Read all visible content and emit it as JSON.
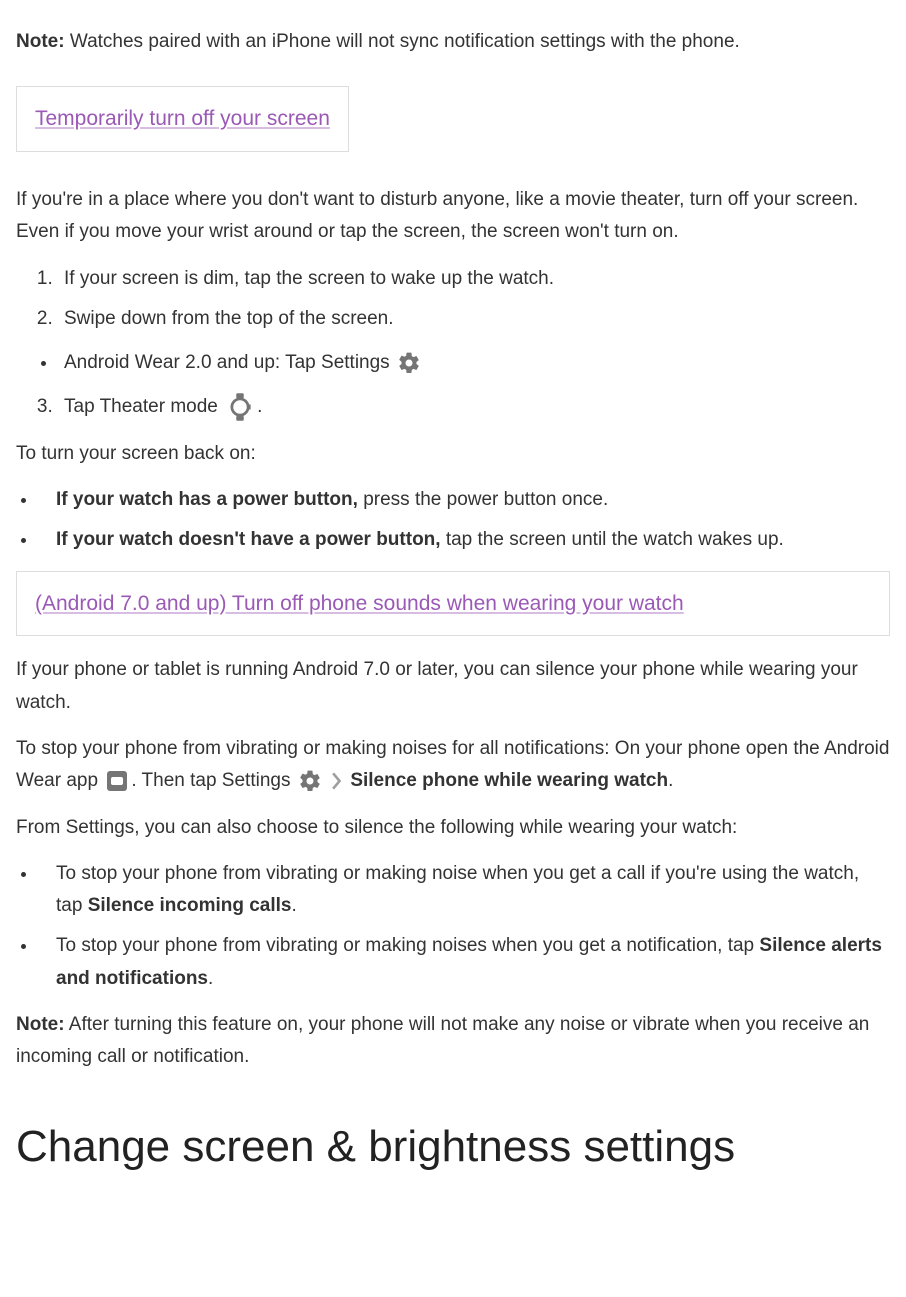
{
  "note1": {
    "label": "Note:",
    "text": " Watches paired with an iPhone will not sync notification settings with the phone."
  },
  "accordion1": {
    "title": "Temporarily turn off your screen"
  },
  "section1": {
    "intro": "If you're in a place where you don't want to disturb anyone, like a movie theater, turn off your screen. Even if you move your wrist around or tap the screen, the screen won't turn on.",
    "step1": "If your screen is dim, tap the screen to wake up the watch.",
    "step2": "Swipe down from the top of the screen.",
    "bullet_a": "Android Wear 2.0 and up: Tap Settings ",
    "step3_a": "Tap Theater mode ",
    "step3_b": ".",
    "back_on": "To turn your screen back on:",
    "power_has_bold": "If your watch has a power button,",
    "power_has_rest": " press the power button once.",
    "power_no_bold": "If your watch doesn't have a power button,",
    "power_no_rest": " tap the screen until the watch wakes up."
  },
  "accordion2": {
    "title": "(Android 7.0 and up) Turn off phone sounds when wearing your watch"
  },
  "section2": {
    "intro": "If your phone or tablet is running Android 7.0 or later, you can silence your phone while wearing your watch.",
    "p2_a": "To stop your phone from vibrating or making noises for all notifications: On your phone open the Android Wear app ",
    "p2_b": ". Then tap Settings ",
    "p2_bold": "Silence phone while wearing watch",
    "p2_c": ".",
    "p3": "From Settings, you can also choose to silence the following while wearing your watch:",
    "b1_a": "To stop your phone from vibrating or making noise when you get a call if you're using the watch, tap ",
    "b1_bold": "Silence incoming calls",
    "b1_b": ".",
    "b2_a": "To stop your phone from vibrating or making noises when you get a notification, tap ",
    "b2_bold": "Silence alerts and notifications",
    "b2_b": "."
  },
  "note2": {
    "label": "Note:",
    "text": " After turning this feature on, your phone will not make any noise or vibrate when you receive an incoming call or notification."
  },
  "heading": "Change screen & brightness settings"
}
